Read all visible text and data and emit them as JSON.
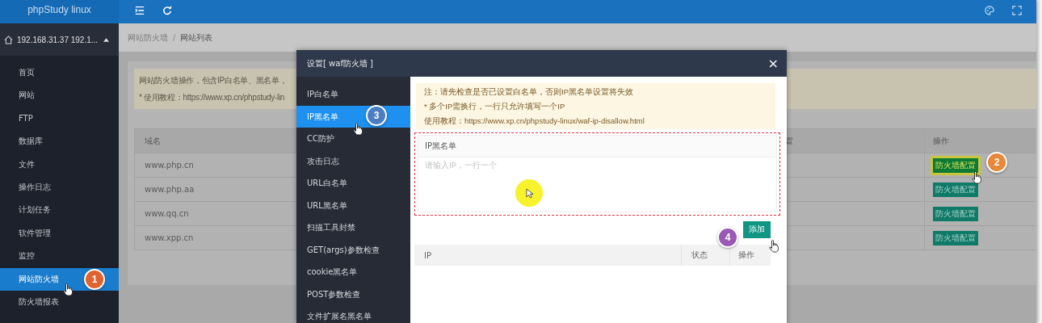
{
  "brand": "phpStudy linux",
  "host": {
    "label": "192.168.31.37 192.1...",
    "expanded": true
  },
  "sidebar": {
    "items": [
      {
        "label": "首页",
        "selected": false
      },
      {
        "label": "网站",
        "selected": false
      },
      {
        "label": "FTP",
        "selected": false
      },
      {
        "label": "数据库",
        "selected": false
      },
      {
        "label": "文件",
        "selected": false
      },
      {
        "label": "操作日志",
        "selected": false
      },
      {
        "label": "计划任务",
        "selected": false
      },
      {
        "label": "软件管理",
        "selected": false
      },
      {
        "label": "监控",
        "selected": false
      },
      {
        "label": "网站防火墙",
        "selected": true
      },
      {
        "label": "防火墙报表",
        "selected": false
      }
    ]
  },
  "breadcrumb": [
    "网站防火墙",
    "/",
    "网站列表"
  ],
  "notice": [
    "网站防火墙操作，包含IP白名单、黑名单，",
    "* 使用教程：https://www.xp.cn/phpstudy-lin"
  ],
  "table": {
    "columns": [
      "域名",
      "置",
      "操作"
    ],
    "rows": [
      {
        "domain": "www.php.cn",
        "action": "防火墙配置",
        "highlighted": true
      },
      {
        "domain": "www.php.aa",
        "action": "防火墙配置",
        "highlighted": false
      },
      {
        "domain": "www.qq.cn",
        "action": "防火墙配置",
        "highlighted": false
      },
      {
        "domain": "www.xpp.cn",
        "action": "防火墙配置",
        "highlighted": false
      }
    ]
  },
  "modal": {
    "title": "设置[ waf防火墙 ]",
    "close": "×",
    "menu": [
      {
        "label": "IP白名单",
        "selected": false
      },
      {
        "label": "IP黑名单",
        "selected": true
      },
      {
        "label": "CC防护",
        "selected": false
      },
      {
        "label": "攻击日志",
        "selected": false
      },
      {
        "label": "URL白名单",
        "selected": false
      },
      {
        "label": "URL黑名单",
        "selected": false
      },
      {
        "label": "扫描工具封禁",
        "selected": false
      },
      {
        "label": "GET(args)参数检查",
        "selected": false
      },
      {
        "label": "cookie黑名单",
        "selected": false
      },
      {
        "label": "POST参数检查",
        "selected": false
      },
      {
        "label": "文件扩展名黑名单",
        "selected": false
      }
    ],
    "notice": [
      "注：请先检查是否已设置白名单，否则IP黑名单设置将失效",
      "* 多个IP需换行，一行只允许填写一个IP",
      "使用教程：https://www.xp.cn/phpstudy-linux/waf-ip-disallow.html"
    ],
    "field": {
      "label": "IP黑名单",
      "placeholder": "请输入IP，一行一个"
    },
    "add_button": "添加",
    "table": {
      "columns": [
        "IP",
        "状态",
        "操作"
      ]
    }
  },
  "markers": [
    {
      "label": "1",
      "color": "#e0622f"
    },
    {
      "label": "2",
      "color": "#e8883a"
    },
    {
      "label": "3",
      "color": "#4a7ec0"
    },
    {
      "label": "4",
      "color": "#9b59b6"
    }
  ]
}
